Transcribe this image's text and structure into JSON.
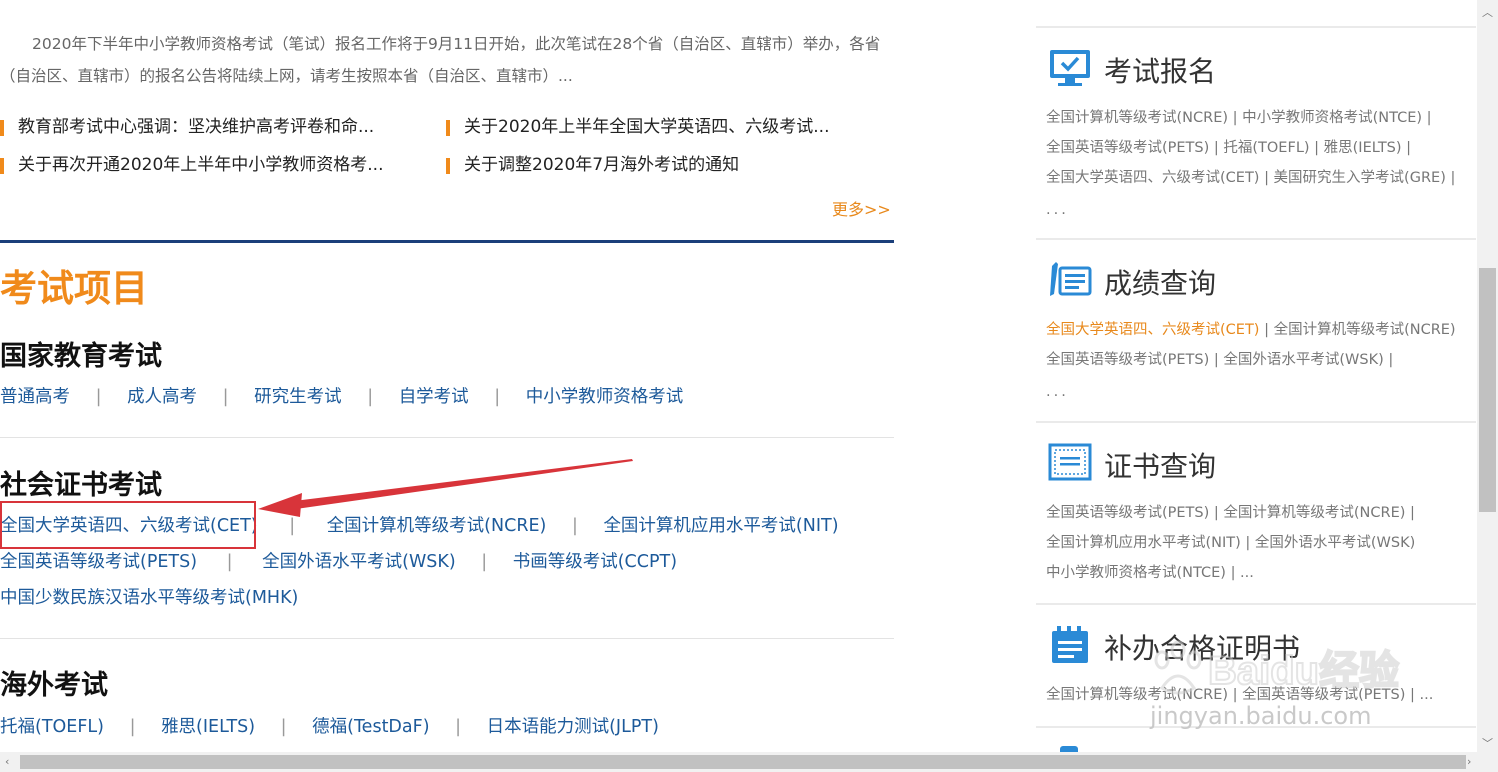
{
  "intro": {
    "text": "2020年下半年中小学教师资格考试（笔试）报名工作将于9月11日开始，此次笔试在28个省（自治区、直辖市）举办，各省（自治区、直辖市）的报名公告将陆续上网，请考生按照本省（自治区、直辖市）..."
  },
  "news": [
    "教育部考试中心强调：坚决维护高考评卷和命...",
    "关于2020年上半年全国大学英语四、六级考试...",
    "关于再次开通2020年上半年中小学教师资格考...",
    "关于调整2020年7月海外考试的通知"
  ],
  "more_label": "更多>>",
  "exam_section": {
    "title": "考试项目",
    "national": {
      "title": "国家教育考试",
      "links": [
        "普通高考",
        "成人高考",
        "研究生考试",
        "自学考试",
        "中小学教师资格考试"
      ]
    },
    "social": {
      "title": "社会证书考试",
      "row1": [
        "全国大学英语四、六级考试(CET)",
        "全国计算机等级考试(NCRE)",
        "全国计算机应用水平考试(NIT)"
      ],
      "row2": [
        "全国英语等级考试(PETS)",
        "全国外语水平考试(WSK)",
        "书画等级考试(CCPT)"
      ],
      "row3": [
        "中国少数民族汉语水平等级考试(MHK)"
      ]
    },
    "overseas": {
      "title": "海外考试",
      "links": [
        "托福(TOEFL)",
        "雅思(IELTS)",
        "德福(TestDaF)",
        "日本语能力测试(JLPT)"
      ]
    },
    "separator": "|"
  },
  "sidebar": {
    "registration": {
      "title": "考试报名",
      "line1": "全国计算机等级考试(NCRE) | 中小学教师资格考试(NTCE) |",
      "line2": "全国英语等级考试(PETS) | 托福(TOEFL) | 雅思(IELTS) |",
      "line3": "全国大学英语四、六级考试(CET) | 美国研究生入学考试(GRE) |",
      "line4": "..."
    },
    "scores": {
      "title": "成绩查询",
      "highlight": "全国大学英语四、六级考试(CET)",
      "line1_rest": " | 全国计算机等级考试(NCRE)",
      "line2": "全国英语等级考试(PETS) | 全国外语水平考试(WSK) |",
      "line3": "..."
    },
    "certificates": {
      "title": "证书查询",
      "line1": "全国英语等级考试(PETS) | 全国计算机等级考试(NCRE) |",
      "line2": "全国计算机应用水平考试(NIT) | 全国外语水平考试(WSK)",
      "line3": "中小学教师资格考试(NTCE) | ..."
    },
    "reissue": {
      "title": "补办合格证明书",
      "line1": "全国计算机等级考试(NCRE) | 全国英语等级考试(PETS) | ..."
    }
  },
  "watermark": {
    "brand": "Baidu经验",
    "url": "jingyan.baidu.com"
  },
  "colors": {
    "accent_orange": "#f08a1b",
    "link_blue": "#1d5a9a",
    "rule_navy": "#1b3f7a",
    "annotation_red": "#d8343a",
    "icon_blue": "#2a8ad6"
  }
}
